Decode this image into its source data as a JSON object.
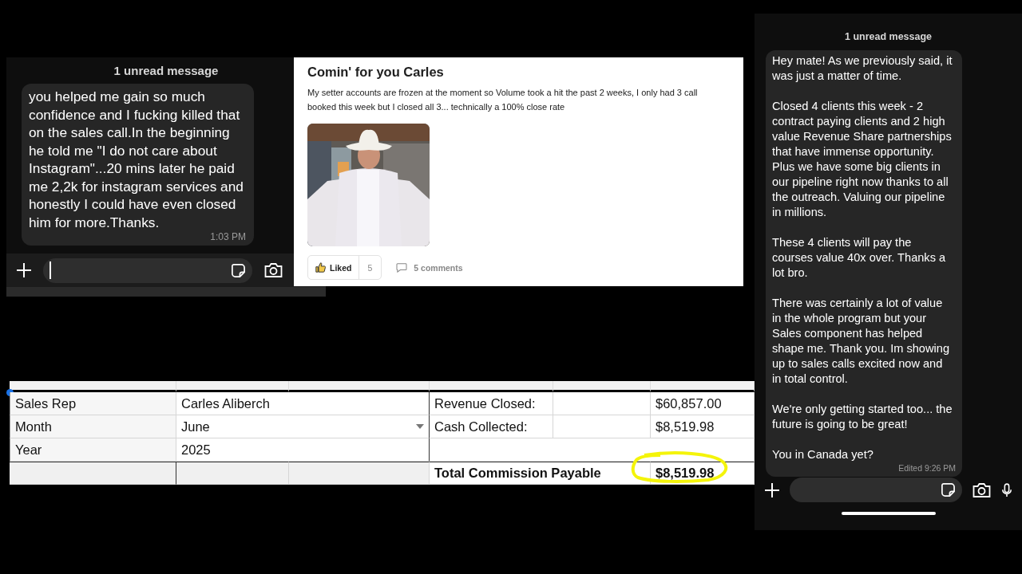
{
  "chat_left": {
    "banner": "1 unread message",
    "message": {
      "paragraphs": [
        "you helped me gain so much confidence and I fucking killed that on the sales call.In the beginning he told me \"I do not care about Instagram\"...20 mins later he paid me 2,2k for instagram services and honestly I could have even closed him for more.Thanks."
      ],
      "time": "1:03 PM"
    },
    "composer": {
      "caret": true,
      "mic": false
    }
  },
  "post": {
    "title": "Comin' for you Carles",
    "body": "My setter accounts are frozen at the moment so Volume took a hit the past 2 weeks, I only had 3 call booked this week but I closed all 3... technically a 100% close rate",
    "like": {
      "label": "Liked",
      "count": "5",
      "selected": true
    },
    "comments": "5 comments"
  },
  "sheet": {
    "rows": [
      {
        "label": "Sales Rep",
        "value": "Carles Aliberch",
        "dropdown": false,
        "right": {
          "kind": "line",
          "label": "Revenue Closed:",
          "value": "$60,857.00"
        }
      },
      {
        "label": "Month",
        "value": "June",
        "dropdown": true,
        "right": {
          "kind": "line",
          "label": "Cash Collected:",
          "value": "$8,519.98"
        }
      },
      {
        "label": "Year",
        "value": "2025",
        "dropdown": false
      },
      {
        "right": {
          "kind": "total",
          "label": "Total Commission Payable",
          "value": "$8,519.98",
          "highlighted": true
        }
      }
    ]
  },
  "chat_right": {
    "banner": "1 unread message",
    "message": {
      "paragraphs": [
        "Hey mate! As we previously said, it was just a matter of time.",
        "Closed 4 clients this week - 2 contract paying clients and 2 high value Revenue Share partnerships that have immense opportunity. Plus we have some big clients in our pipeline right now thanks to all the outreach. Valuing our pipeline in millions.",
        "These 4 clients will pay the courses value 40x over. Thanks a lot bro.",
        "There was certainly a lot of value in the whole program but your Sales component has helped shape me. Thank you. Im showing up to sales calls excited now and in total control.",
        "We're only getting started too... the future is going to be great!",
        "You in Canada yet?"
      ],
      "time": "Edited 9:26 PM"
    },
    "composer": {
      "caret": false,
      "mic": true
    }
  }
}
